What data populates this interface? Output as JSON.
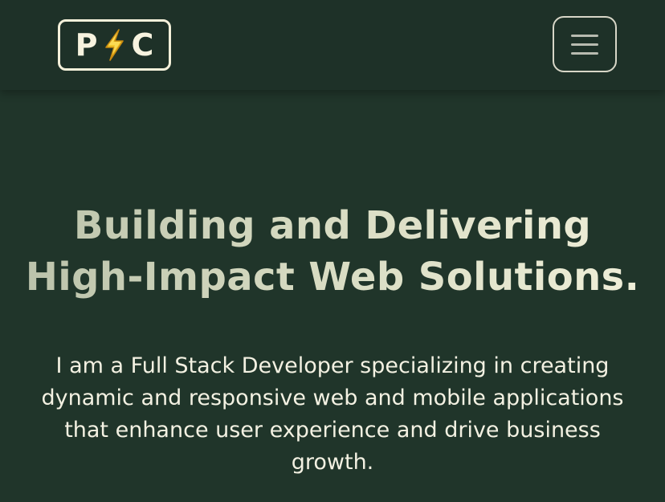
{
  "header": {
    "logo": {
      "left_letter": "P",
      "right_letter": "C",
      "icon": "lightning-bolt-icon"
    },
    "menu_button": {
      "icon": "hamburger-icon"
    }
  },
  "hero": {
    "headline_line_1": "Building and Delivering",
    "headline_line_2": "High-Impact Web Solutions.",
    "intro": "I am a Full Stack Developer specializing in creating dynamic and responsive web and mobile applications that enhance user experience and drive business growth."
  },
  "colors": {
    "background": "#20352a",
    "header_background": "#1e3128",
    "logo_border": "#f4f0da",
    "bolt_yellow": "#f4c82b",
    "headline_gradient_start": "#b9c1a9",
    "headline_gradient_end": "#f1f0da",
    "body_text": "#f3f1e2"
  }
}
